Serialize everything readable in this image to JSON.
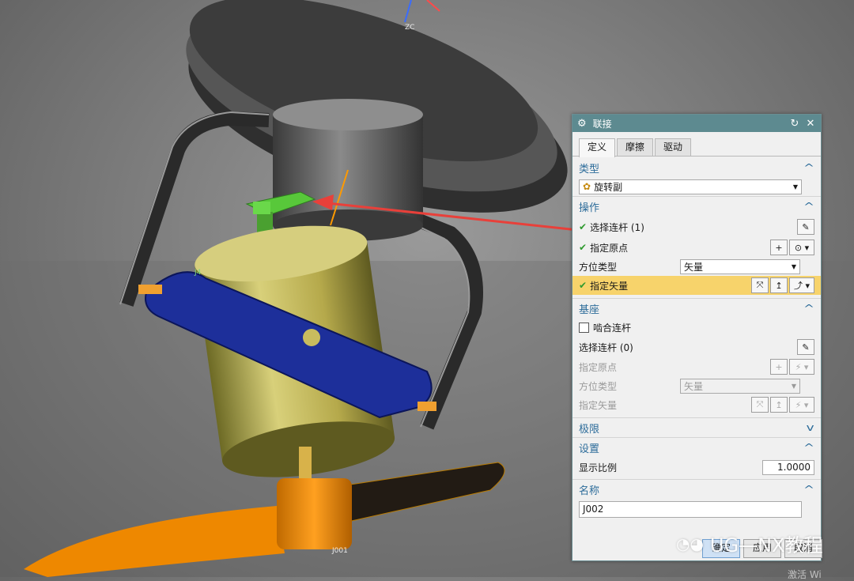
{
  "viewport": {
    "triad_label": "ZC",
    "joint_label": "J001",
    "link_tag": "J4"
  },
  "dialog": {
    "title": "联接",
    "title_icon": "gear-icon",
    "tabs": [
      {
        "label": "定义",
        "active": true
      },
      {
        "label": "摩擦",
        "active": false
      },
      {
        "label": "驱动",
        "active": false
      }
    ],
    "type_section": {
      "header": "类型",
      "selected": "旋转副"
    },
    "operation_section": {
      "header": "操作",
      "select_link": "选择连杆 (1)",
      "specify_origin": "指定原点",
      "orientation_type_label": "方位类型",
      "orientation_type_value": "矢量",
      "specify_vector": "指定矢量"
    },
    "base_section": {
      "header": "基座",
      "engage_link": "啮合连杆",
      "select_link": "选择连杆 (0)",
      "specify_origin": "指定原点",
      "orientation_type_label": "方位类型",
      "orientation_type_value": "矢量",
      "specify_vector": "指定矢量"
    },
    "limits_section": {
      "header": "极限"
    },
    "settings_section": {
      "header": "设置",
      "display_scale_label": "显示比例",
      "display_scale_value": "1.0000"
    },
    "name_section": {
      "header": "名称",
      "name_value": "J002"
    },
    "buttons": {
      "ok": "确定",
      "apply": "应用",
      "cancel": "取消"
    }
  },
  "watermark": "UG—NX教程",
  "activate_text": "激活 Wi",
  "colors": {
    "titlebar": "#5d8a90",
    "highlight_row": "#f7d36b",
    "section_header": "#2d6c9a",
    "arrow": "#e8403a"
  }
}
